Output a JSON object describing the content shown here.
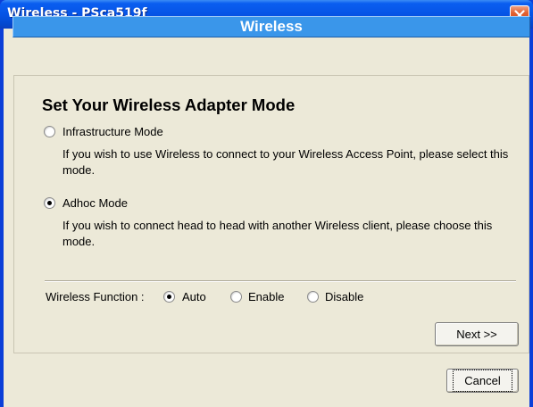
{
  "window": {
    "title": "Wireless - PSca519f",
    "close_icon": "close-icon"
  },
  "header": {
    "title": "Wireless"
  },
  "main": {
    "heading": "Set Your Wireless Adapter Mode",
    "modes": [
      {
        "label": "Infrastructure Mode",
        "description": "If you wish to use Wireless to connect to your Wireless Access Point, please select this mode.",
        "selected": false
      },
      {
        "label": "Adhoc Mode",
        "description": "If you wish to connect head to head with another Wireless client, please choose this mode.",
        "selected": true
      }
    ],
    "wireless_function": {
      "label": "Wireless Function :",
      "options": [
        {
          "label": "Auto",
          "selected": true
        },
        {
          "label": "Enable",
          "selected": false
        },
        {
          "label": "Disable",
          "selected": false
        }
      ]
    },
    "next_label": "Next >>"
  },
  "footer": {
    "cancel_label": "Cancel"
  },
  "colors": {
    "titlebar": "#0654e6",
    "header_bar": "#3a96ea",
    "dialog_bg": "#ece9d8"
  }
}
